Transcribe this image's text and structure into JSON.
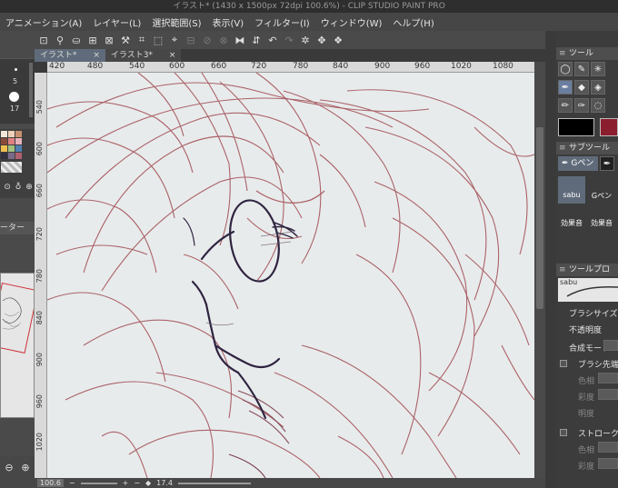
{
  "window": {
    "title": "イラスト* (1430 x 1500px 72dpi 100.6%) - CLIP STUDIO PAINT PRO"
  },
  "menu": [
    "アニメーション(A)",
    "レイヤー(L)",
    "選択範囲(S)",
    "表示(V)",
    "フィルター(I)",
    "ウィンドウ(W)",
    "ヘルプ(H)"
  ],
  "tabs": [
    {
      "label": "イラスト*",
      "close": "×"
    },
    {
      "label": "イラスト3*",
      "close": "×"
    }
  ],
  "ruler": {
    "h": [
      "420",
      "480",
      "540",
      "600",
      "660",
      "720",
      "780",
      "840",
      "900",
      "960",
      "1020",
      "1080"
    ],
    "v": [
      "540",
      "600",
      "660",
      "720",
      "780",
      "840",
      "900",
      "960",
      "1020"
    ]
  },
  "status": {
    "zoom": "100.6",
    "angle": "17.4"
  },
  "left": {
    "brush_sizes": [
      "5",
      "17"
    ],
    "panel_label": "ーター"
  },
  "right": {
    "tool_header": "ツール",
    "subtool_header": "サブツール",
    "subtool_tab": "Gペン",
    "subtools": [
      "sabu",
      "Gペン",
      "効果音",
      "効果音"
    ],
    "property_header": "ツールプロ",
    "brush_name": "sabu",
    "props": [
      "ブラシサイズ",
      "不透明度",
      "合成モード",
      "ブラシ先端",
      "色相",
      "彩度",
      "明度",
      "ストローク",
      "色相",
      "彩度"
    ]
  },
  "colors": {
    "main": "#000000",
    "sub": "#8b1e2e",
    "accent": "#5f6b7a",
    "sketch": "#a4545a"
  }
}
